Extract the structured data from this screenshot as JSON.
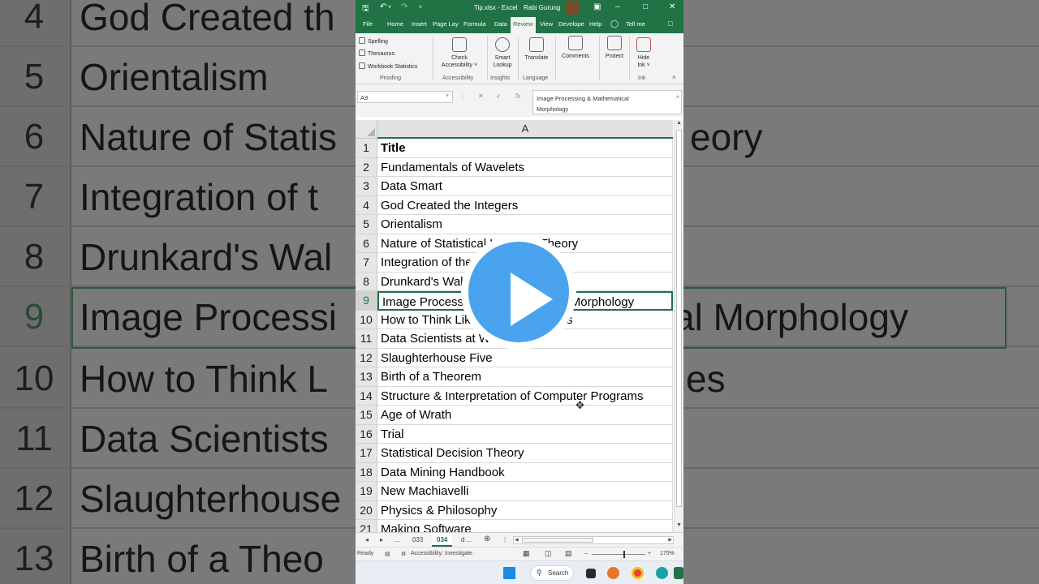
{
  "window": {
    "title": "Tip.xlsx  -  Excel",
    "user": "Rabi Gurung"
  },
  "ribbon_tabs": [
    {
      "label": "File"
    },
    {
      "label": "Home"
    },
    {
      "label": "Insert"
    },
    {
      "label": "Page Lay"
    },
    {
      "label": "Formula"
    },
    {
      "label": "Data"
    },
    {
      "label": "Review"
    },
    {
      "label": "View"
    },
    {
      "label": "Develope"
    },
    {
      "label": "Help"
    },
    {
      "label": "Tell me"
    }
  ],
  "ribbon": {
    "spelling": "Spelling",
    "thesaurus": "Thesaurus",
    "workbook_statistics": "Workbook Statistics",
    "proofing": "Proofing",
    "check_accessibility_1": "Check",
    "check_accessibility_2": "Accessibility ˅",
    "accessibility": "Accessibility",
    "smart_lookup_1": "Smart",
    "smart_lookup_2": "Lookup",
    "insights": "Insights",
    "translate": "Translate",
    "language": "Language",
    "comments": "Comments",
    "protect": "Protect",
    "hide_ink_1": "Hide",
    "hide_ink_2": "Ink ˅",
    "ink": "Ink"
  },
  "formula_bar": {
    "name_box": "A9",
    "fx": "fx",
    "formula_line1": "Image Processing & Mathematical",
    "formula_line2": "Morphology"
  },
  "sheet": {
    "column_header": "A",
    "selected_row": 9,
    "rows": [
      {
        "num": "1",
        "value": "Title"
      },
      {
        "num": "2",
        "value": "Fundamentals of Wavelets"
      },
      {
        "num": "3",
        "value": "Data Smart"
      },
      {
        "num": "4",
        "value": "God Created the Integers"
      },
      {
        "num": "5",
        "value": "Orientalism"
      },
      {
        "num": "6",
        "value": "Nature of Statistical Learning Theory"
      },
      {
        "num": "7",
        "value": "Integration of the Indian State"
      },
      {
        "num": "8",
        "value": "Drunkard's Walk, The"
      },
      {
        "num": "9",
        "value": "Image Processing & Mathematical Morphology"
      },
      {
        "num": "10",
        "value": "How to Think Like Sherlock Holmes"
      },
      {
        "num": "11",
        "value": "Data Scientists at Work"
      },
      {
        "num": "12",
        "value": "Slaughterhouse Five"
      },
      {
        "num": "13",
        "value": "Birth of a Theorem"
      },
      {
        "num": "14",
        "value": "Structure & Interpretation of Computer Programs"
      },
      {
        "num": "15",
        "value": "Age of Wrath"
      },
      {
        "num": "16",
        "value": "Trial"
      },
      {
        "num": "17",
        "value": "Statistical Decision Theory"
      },
      {
        "num": "18",
        "value": "Data Mining Handbook"
      },
      {
        "num": "19",
        "value": "New Machiavelli"
      },
      {
        "num": "20",
        "value": "Physics & Philosophy"
      },
      {
        "num": "21",
        "value": "Making Software"
      }
    ]
  },
  "sheet_tabs": {
    "more_left": "...",
    "tab1": "033",
    "tab2": "034",
    "tab3": "d ..."
  },
  "status": {
    "ready": "Ready",
    "accessibility": "Accessibility: Investigate",
    "zoom": "175%"
  },
  "taskbar": {
    "search": "Search"
  },
  "background_rows": [
    {
      "num": "4",
      "text": "God Created th"
    },
    {
      "num": "5",
      "text": "Orientalism"
    },
    {
      "num": "6",
      "text": "Nature of Statis"
    },
    {
      "num": "7",
      "text": "Integration of t"
    },
    {
      "num": "8",
      "text": "Drunkard's Wal"
    },
    {
      "num": "9",
      "text": "Image Processi"
    },
    {
      "num": "10",
      "text": "How to Think L"
    },
    {
      "num": "11",
      "text": "Data Scientists"
    },
    {
      "num": "12",
      "text": "Slaughterhouse"
    },
    {
      "num": "13",
      "text": "Birth of a Theo"
    }
  ],
  "background_right": [
    {
      "text": "eory"
    },
    {
      "text": "al Morphology"
    },
    {
      "text": "es"
    }
  ],
  "colors": {
    "excel_green": "#217346",
    "play_blue": "#4aa3ef"
  },
  "icons": [
    "save-icon",
    "undo-icon",
    "redo-icon",
    "lightbulb-icon",
    "comment-icon",
    "play-icon",
    "windows-icon",
    "search-icon"
  ]
}
